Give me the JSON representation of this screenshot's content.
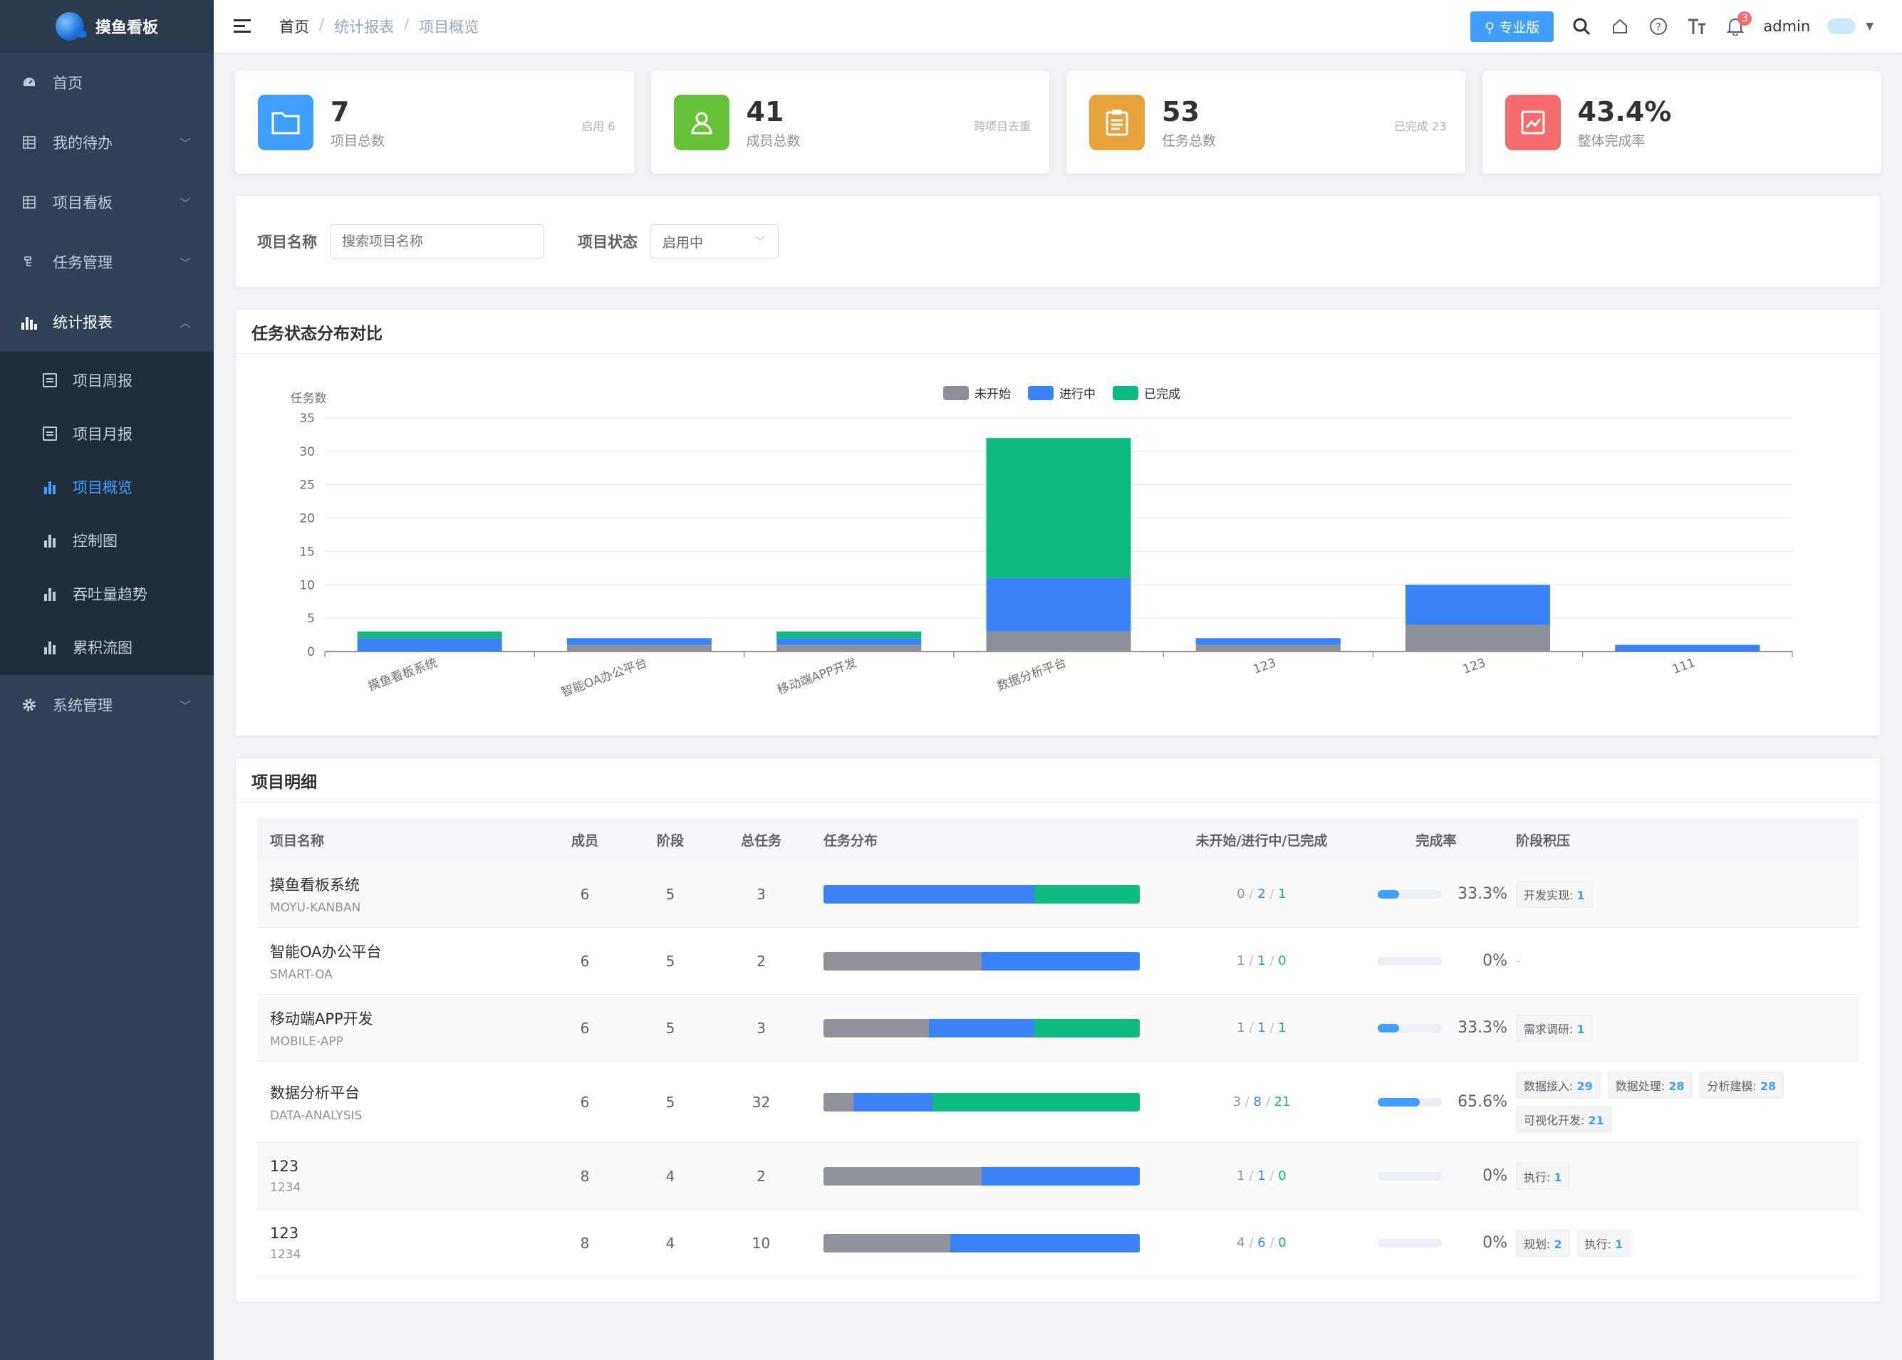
{
  "app": {
    "logo_text": "摸鱼看板"
  },
  "sidebar": {
    "items": [
      {
        "label": "首页",
        "icon": "dashboard-icon"
      },
      {
        "label": "我的待办",
        "icon": "table-icon"
      },
      {
        "label": "项目看板",
        "icon": "table-icon"
      },
      {
        "label": "任务管理",
        "icon": "tree-icon"
      },
      {
        "label": "统计报表",
        "icon": "chart-icon"
      },
      {
        "label": "系统管理",
        "icon": "gear-icon"
      }
    ],
    "subitems": [
      {
        "label": "项目周报"
      },
      {
        "label": "项目月报"
      },
      {
        "label": "项目概览"
      },
      {
        "label": "控制图"
      },
      {
        "label": "吞吐量趋势"
      },
      {
        "label": "累积流图"
      }
    ]
  },
  "navbar": {
    "breadcrumb": [
      "首页",
      "统计报表",
      "项目概览"
    ],
    "pro_label": "专业版",
    "badge_count": "3",
    "username": "admin"
  },
  "stats": [
    {
      "value": "7",
      "label": "项目总数",
      "extra": "启用 6",
      "color": "#409eff",
      "icon": "folder-icon"
    },
    {
      "value": "41",
      "label": "成员总数",
      "extra": "跨项目去重",
      "color": "#67c23a",
      "icon": "user-icon"
    },
    {
      "value": "53",
      "label": "任务总数",
      "extra": "已完成 23",
      "color": "#e6a23c",
      "icon": "clipboard-icon"
    },
    {
      "value": "43.4%",
      "label": "整体完成率",
      "extra": "",
      "color": "#f56c6c",
      "icon": "trend-icon"
    }
  ],
  "filter": {
    "name_label": "项目名称",
    "name_placeholder": "搜索项目名称",
    "status_label": "项目状态",
    "status_value": "启用中"
  },
  "chart_section": {
    "title": "任务状态分布对比"
  },
  "chart_data": {
    "type": "bar",
    "stacked": true,
    "ylabel": "任务数",
    "ylim": [
      0,
      35
    ],
    "yticks": [
      0,
      5,
      10,
      15,
      20,
      25,
      30,
      35
    ],
    "categories": [
      "摸鱼看板系统",
      "智能OA办公平台",
      "移动端APP开发",
      "数据分析平台",
      "123",
      "123",
      "111"
    ],
    "series": [
      {
        "name": "未开始",
        "color": "#8b9098",
        "values": [
          0,
          1,
          1,
          3,
          1,
          4,
          0
        ]
      },
      {
        "name": "进行中",
        "color": "#3b82f6",
        "values": [
          2,
          1,
          1,
          8,
          1,
          6,
          1
        ]
      },
      {
        "name": "已完成",
        "color": "#10b981",
        "values": [
          1,
          0,
          1,
          21,
          0,
          0,
          0
        ]
      }
    ],
    "legend": "top-center",
    "grid": true
  },
  "table_section": {
    "title": "项目明细"
  },
  "table": {
    "headers": [
      "项目名称",
      "成员",
      "阶段",
      "总任务",
      "任务分布",
      "未开始/进行中/已完成",
      "完成率",
      "阶段积压"
    ],
    "rows": [
      {
        "name": "摸鱼看板系统",
        "code": "MOYU-KANBAN",
        "members": "6",
        "stages": "5",
        "total": "3",
        "ns": 0,
        "ip": 2,
        "dn": 1,
        "ns_text": "0",
        "ip_text": "2",
        "dn_text": "1",
        "rate": "33.3%",
        "rate_frac": 0.333,
        "backlog": [
          {
            "label": "开发实现:",
            "count": "1"
          }
        ]
      },
      {
        "name": "智能OA办公平台",
        "code": "SMART-OA",
        "members": "6",
        "stages": "5",
        "total": "2",
        "ns": 1,
        "ip": 1,
        "dn": 0,
        "ns_text": "1",
        "ip_text": "1",
        "dn_text": "0",
        "rate": "0%",
        "rate_frac": 0,
        "backlog": [],
        "backlog_empty": "-"
      },
      {
        "name": "移动端APP开发",
        "code": "MOBILE-APP",
        "members": "6",
        "stages": "5",
        "total": "3",
        "ns": 1,
        "ip": 1,
        "dn": 1,
        "ns_text": "1",
        "ip_text": "1",
        "dn_text": "1",
        "rate": "33.3%",
        "rate_frac": 0.333,
        "backlog": [
          {
            "label": "需求调研:",
            "count": "1"
          }
        ]
      },
      {
        "name": "数据分析平台",
        "code": "DATA-ANALYSIS",
        "members": "6",
        "stages": "5",
        "total": "32",
        "ns": 3,
        "ip": 8,
        "dn": 21,
        "ns_text": "3",
        "ip_text": "8",
        "dn_text": "21",
        "rate": "65.6%",
        "rate_frac": 0.656,
        "backlog": [
          {
            "label": "数据接入:",
            "count": "29"
          },
          {
            "label": "数据处理:",
            "count": "28"
          },
          {
            "label": "分析建模:",
            "count": "28"
          },
          {
            "label": "可视化开发:",
            "count": "21"
          }
        ]
      },
      {
        "name": "123",
        "code": "1234",
        "members": "8",
        "stages": "4",
        "total": "2",
        "ns": 1,
        "ip": 1,
        "dn": 0,
        "ns_text": "1",
        "ip_text": "1",
        "dn_text": "0",
        "rate": "0%",
        "rate_frac": 0,
        "backlog": [
          {
            "label": "执行:",
            "count": "1"
          }
        ]
      },
      {
        "name": "123",
        "code": "1234",
        "members": "8",
        "stages": "4",
        "total": "10",
        "ns": 4,
        "ip": 6,
        "dn": 0,
        "ns_text": "4",
        "ip_text": "6",
        "dn_text": "0",
        "rate": "0%",
        "rate_frac": 0,
        "backlog": [
          {
            "label": "规划:",
            "count": "2"
          },
          {
            "label": "执行:",
            "count": "1"
          }
        ]
      }
    ]
  }
}
